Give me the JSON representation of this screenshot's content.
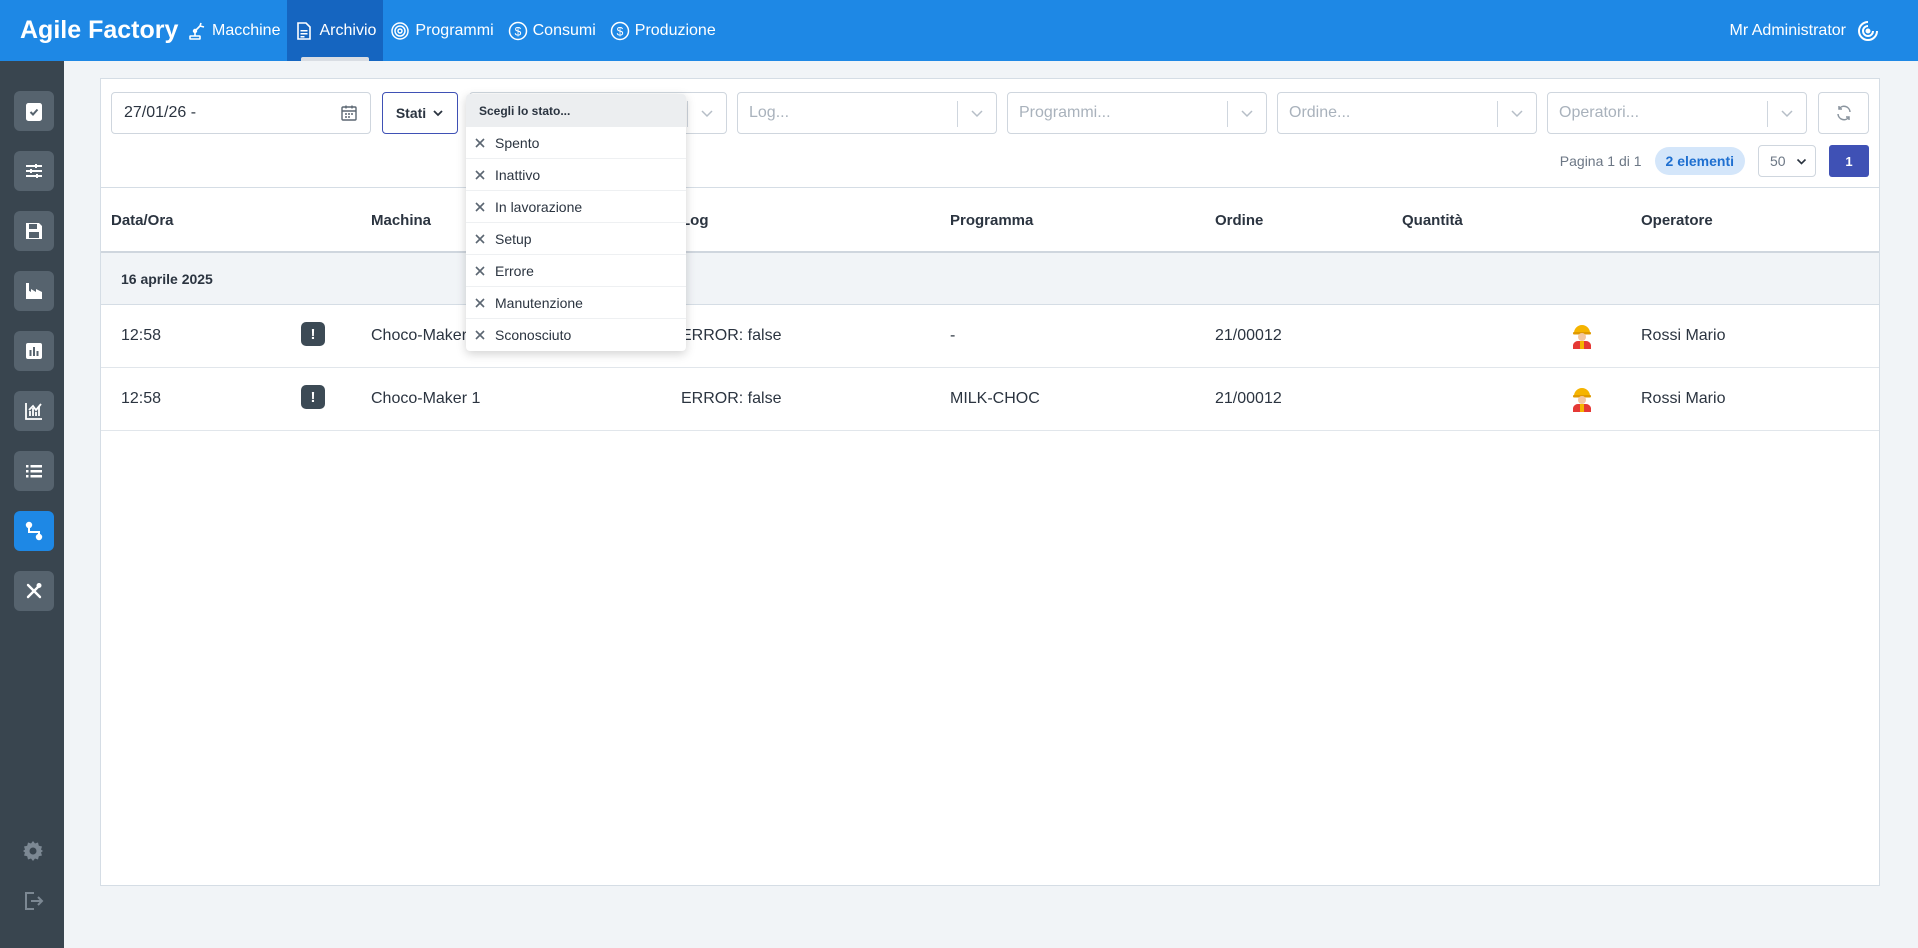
{
  "header": {
    "brand": "Agile Factory",
    "nav": [
      {
        "label": "Macchine",
        "icon": "robot-arm-icon"
      },
      {
        "label": "Archivio",
        "icon": "document-icon",
        "active": true
      },
      {
        "label": "Programmi",
        "icon": "target-icon"
      },
      {
        "label": "Consumi",
        "icon": "dollar-icon"
      },
      {
        "label": "Produzione",
        "icon": "dollar-icon"
      }
    ],
    "user": "Mr Administrator",
    "colors": {
      "bar": "#1e88e5",
      "active": "#1565c0"
    }
  },
  "sidebar": {
    "items": [
      {
        "icon": "clipboard-check-icon"
      },
      {
        "icon": "sliders-icon"
      },
      {
        "icon": "save-icon"
      },
      {
        "icon": "factory-icon"
      },
      {
        "icon": "bar-chart-icon"
      },
      {
        "icon": "line-chart-icon"
      },
      {
        "icon": "list-icon"
      },
      {
        "icon": "flow-icon",
        "active": true
      },
      {
        "icon": "tools-icon"
      }
    ],
    "bottom": [
      {
        "icon": "gear-icon"
      },
      {
        "icon": "logout-icon"
      }
    ]
  },
  "filters": {
    "date": "27/01/26 -",
    "stati_label": "Stati",
    "log_placeholder": "Log...",
    "programmi_placeholder": "Programmi...",
    "ordine_placeholder": "Ordine...",
    "operatori_placeholder": "Operatori..."
  },
  "pager": {
    "text": "Pagina 1 di 1",
    "count": "2 elementi",
    "per_page": "50",
    "page": "1"
  },
  "table": {
    "columns": [
      "Data/Ora",
      "Machina",
      "Log",
      "Programma",
      "Ordine",
      "Quantità",
      "Operatore"
    ],
    "group_date": "16 aprile 2025",
    "rows": [
      {
        "time": "12:58",
        "machine": "Choco-Maker 1",
        "log": "ERROR: false",
        "program": "-",
        "order": "21/00012",
        "quantity": "",
        "operator": "Rossi Mario"
      },
      {
        "time": "12:58",
        "machine": "Choco-Maker 1",
        "log": "ERROR: false",
        "program": "MILK-CHOC",
        "order": "21/00012",
        "quantity": "",
        "operator": "Rossi Mario"
      }
    ]
  },
  "dropdown": {
    "header": "Scegli lo stato...",
    "items": [
      "Spento",
      "Inattivo",
      "In lavorazione",
      "Setup",
      "Errore",
      "Manutenzione",
      "Sconosciuto"
    ]
  }
}
